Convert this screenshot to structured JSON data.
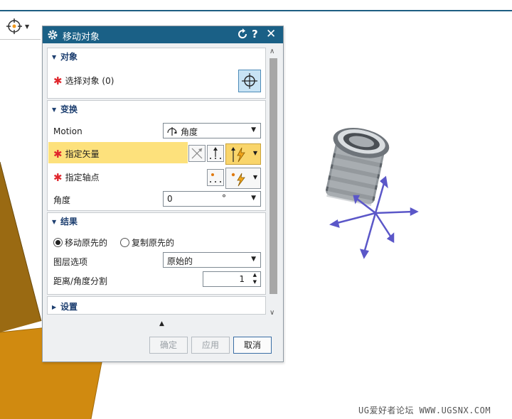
{
  "dialog": {
    "title": "移动对象",
    "help_label": "?",
    "close_label": "✕"
  },
  "sections": {
    "object": {
      "title": "对象",
      "select_label": "选择对象 (0)"
    },
    "transform": {
      "title": "变换",
      "motion_label": "Motion",
      "motion_value": "角度",
      "vector_label": "指定矢量",
      "axis_point_label": "指定轴点",
      "angle_label": "角度",
      "angle_value": "0",
      "angle_unit": "°"
    },
    "result": {
      "title": "结果",
      "move_original_label": "移动原先的",
      "move_original_selected": true,
      "copy_original_label": "复制原先的",
      "copy_original_selected": false,
      "layer_option_label": "图层选项",
      "layer_option_value": "原始的",
      "distance_label": "距离/角度分割",
      "distance_value": "1"
    },
    "settings": {
      "title": "设置"
    }
  },
  "buttons": {
    "ok": "确定",
    "apply": "应用",
    "cancel": "取消"
  },
  "watermark": "UG爱好者论坛 WWW.UGSNX.COM",
  "colors": {
    "titlebar": "#1a6086",
    "highlight": "#fde17c",
    "required": "#e0262c",
    "section_title": "#1d3f70",
    "plane_brown": "#9a6a12",
    "plane_orange": "#d08a10",
    "triad_arrow": "#5b57c8"
  },
  "icons": [
    "snap-target-icon",
    "settings-gear-icon",
    "reset-icon",
    "crosshair-select-icon",
    "angle-motion-icon",
    "vector-dialog-icon",
    "vector-infer-icon",
    "point-dialog-icon",
    "point-infer-icon",
    "lightning-icon"
  ]
}
